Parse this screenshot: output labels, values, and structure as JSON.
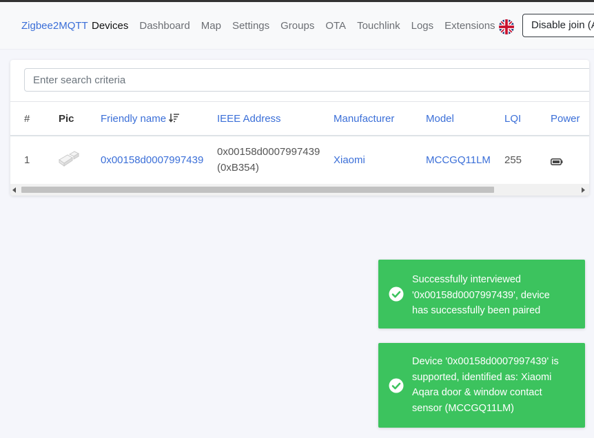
{
  "navbar": {
    "brand": "Zigbee2MQTT",
    "links": [
      "Devices",
      "Dashboard",
      "Map",
      "Settings",
      "Groups",
      "OTA",
      "Touchlink",
      "Logs",
      "Extensions"
    ],
    "active": "Devices",
    "language_icon": "uk-flag-icon",
    "join_button": "Disable join (A"
  },
  "search": {
    "placeholder": "Enter search criteria"
  },
  "table": {
    "headers": {
      "index": "#",
      "pic": "Pic",
      "friendly_name": "Friendly name",
      "ieee": "IEEE Address",
      "manufacturer": "Manufacturer",
      "model": "Model",
      "lqi": "LQI",
      "power": "Power"
    },
    "sort_icon": "sort-descending-icon",
    "rows": [
      {
        "index": "1",
        "pic_icon": "door-window-sensor-icon",
        "friendly_name": "0x00158d0007997439",
        "ieee_line1": "0x00158d0007997439",
        "ieee_line2": "(0xB354)",
        "manufacturer": "Xiaomi",
        "model": "MCCGQ11LM",
        "lqi": "255",
        "power_icon": "battery-icon"
      }
    ]
  },
  "toasts": [
    {
      "message": "Successfully interviewed\n'0x00158d0007997439', device\nhas successfully been paired",
      "icon": "check-circle-icon"
    },
    {
      "message": "Device '0x00158d0007997439' is\nsupported, identified as: Xiaomi\nAqara door & window contact\nsensor (MCCGQ11LM)",
      "icon": "check-circle-icon"
    }
  ],
  "colors": {
    "link": "#3b6fd8",
    "toast": "#3cc35e",
    "background": "#f5f6fb"
  }
}
